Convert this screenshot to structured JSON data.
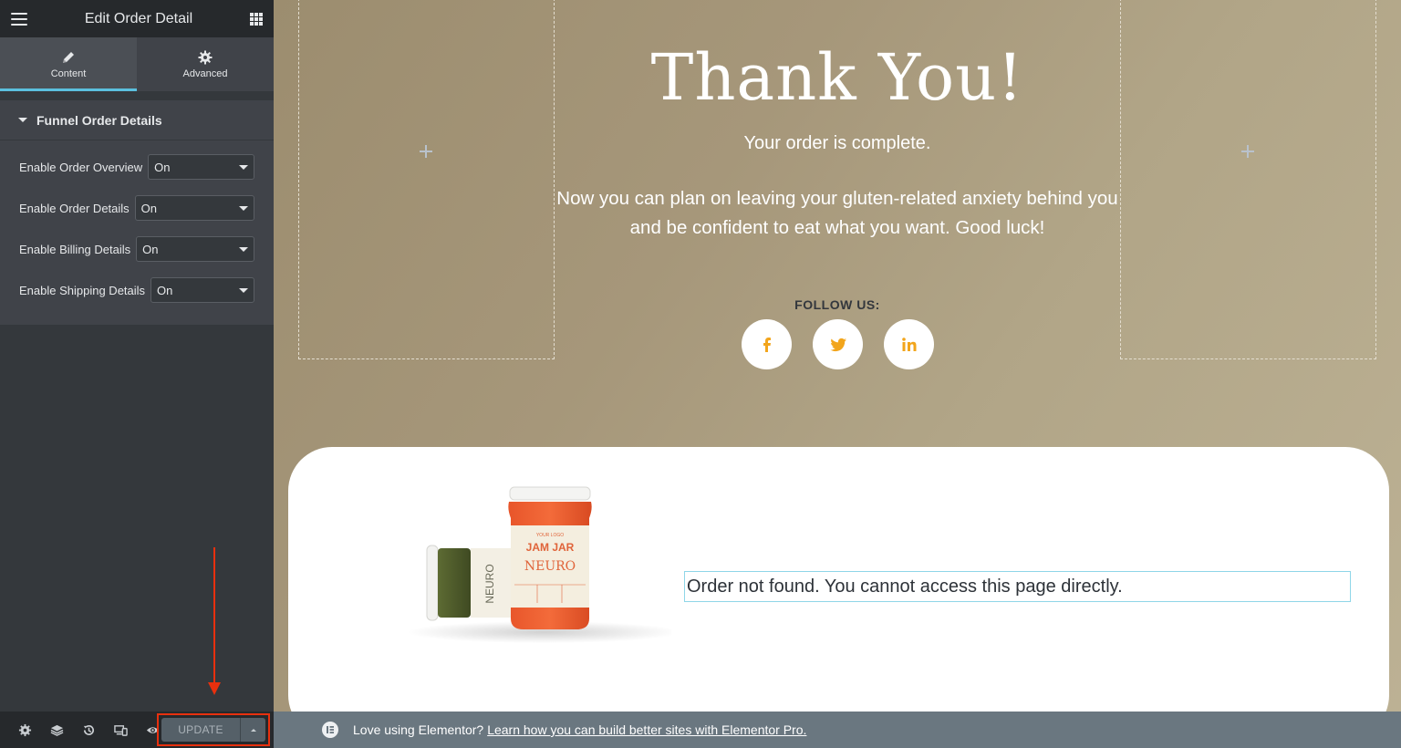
{
  "panel": {
    "title": "Edit Order Detail",
    "menu_icon": "hamburger-icon",
    "apps_icon": "grid-icon",
    "tabs": [
      {
        "label": "Content",
        "icon": "pencil-icon",
        "active": true
      },
      {
        "label": "Advanced",
        "icon": "gear-icon",
        "active": false
      }
    ],
    "section": {
      "title": "Funnel Order Details",
      "expanded": true
    },
    "controls": [
      {
        "label": "Enable Order Overview",
        "value": "On"
      },
      {
        "label": "Enable Order Details",
        "value": "On"
      },
      {
        "label": "Enable Billing Details",
        "value": "On"
      },
      {
        "label": "Enable Shipping Details",
        "value": "On"
      }
    ],
    "footer": {
      "icons": [
        "settings-icon",
        "layers-icon",
        "history-icon",
        "responsive-icon",
        "preview-eye-icon"
      ],
      "update_label": "UPDATE"
    }
  },
  "annotation": {
    "highlight_color": "#e8300e",
    "target": "UPDATE"
  },
  "canvas": {
    "heading": "Thank You!",
    "subheading": "Your order is complete.",
    "paragraph": "Now you can plan on leaving your gluten-related anxiety behind you and be confident to eat what you want. Good luck!",
    "follow_label": "FOLLOW US:",
    "socials": [
      {
        "name": "facebook",
        "glyph": "f"
      },
      {
        "name": "twitter",
        "glyph": "twitter"
      },
      {
        "name": "linkedin",
        "glyph": "in"
      }
    ],
    "social_color": "#f2a51c",
    "product_image": {
      "alt": "Jam jar product photo",
      "front_label_top": "YOUR LOGO",
      "front_label_title": "JAM JAR",
      "front_label_brand": "NEURO",
      "back_label": "NEURO"
    },
    "order_message": "Order not found. You cannot access this page directly."
  },
  "promo": {
    "text": "Love using Elementor?",
    "link_text": "Learn how you can build better sites with Elementor Pro."
  }
}
